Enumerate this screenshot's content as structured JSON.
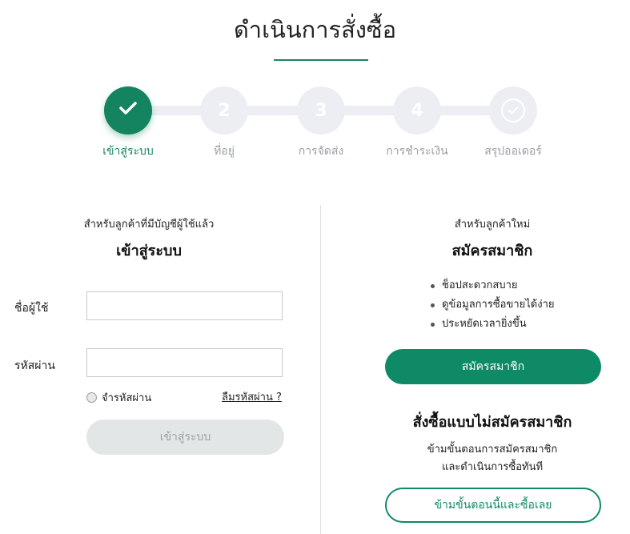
{
  "page": {
    "title": "ดำเนินการสั่งซื้อ"
  },
  "steps": [
    {
      "number": "",
      "label": "เข้าสู่ระบบ",
      "state": "active",
      "icon": "check-icon"
    },
    {
      "number": "2",
      "label": "ที่อยู่",
      "state": "inactive"
    },
    {
      "number": "3",
      "label": "การจัดส่ง",
      "state": "inactive"
    },
    {
      "number": "4",
      "label": "การชำระเงิน",
      "state": "inactive"
    },
    {
      "number": "",
      "label": "สรุปออเดอร์",
      "state": "inactive",
      "icon": "check-circle-icon"
    }
  ],
  "login": {
    "subtitle": "สำหรับลูกค้าที่มีบัญชีผู้ใช้แล้ว",
    "heading": "เข้าสู่ระบบ",
    "username_label": "ชื่อผู้ใช้",
    "username_value": "",
    "password_label": "รหัสผ่าน",
    "password_value": "",
    "remember_label": "จำรหัสผ่าน",
    "forgot_label": "ลืมรหัสผ่าน ?",
    "submit_label": "เข้าสู่ระบบ"
  },
  "register": {
    "subtitle": "สำหรับลูกค้าใหม่",
    "heading": "สมัครสมาชิก",
    "benefits": [
      "ช็อปสะดวกสบาย",
      "ดูข้อมูลการซื้อขายได้ง่าย",
      "ประหยัดเวลายิ่งขึ้น"
    ],
    "button_label": "สมัครสมาชิก"
  },
  "guest": {
    "heading": "สั่งซื้อแบบไม่สมัครสมาชิก",
    "desc_line1": "ข้ามขั้นตอนการสมัครสมาชิก",
    "desc_line2": "และดำเนินการซื้อทันที",
    "button_label": "ข้ามขั้นตอนนี้และซื้อเลย"
  },
  "colors": {
    "brand_green": "#0e8a66",
    "step_inactive": "#eceef3",
    "disabled_button": "#e3e6e6"
  }
}
